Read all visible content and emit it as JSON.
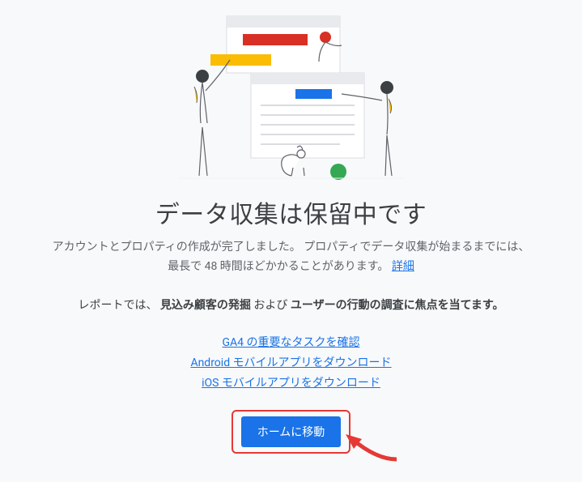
{
  "heading": "データ収集は保留中です",
  "subtext_line1": "アカウントとプロパティの作成が完了しました。 プロパティでデータ収集が始まるまでには、",
  "subtext_line2_pre": "最長で 48 時間ほどかかることがあります。 ",
  "subtext_detail_link": "詳細",
  "report_prefix": "レポートでは、",
  "report_b1": "見込み顧客の発掘",
  "report_mid": " および ",
  "report_b2": "ユーザーの行動の調査に焦点を当てます。",
  "links": {
    "ga4": "GA4 の重要なタスクを確認",
    "android": "Android モバイルアプリをダウンロード",
    "ios": "iOS モバイルアプリをダウンロード"
  },
  "button": "ホームに移動"
}
